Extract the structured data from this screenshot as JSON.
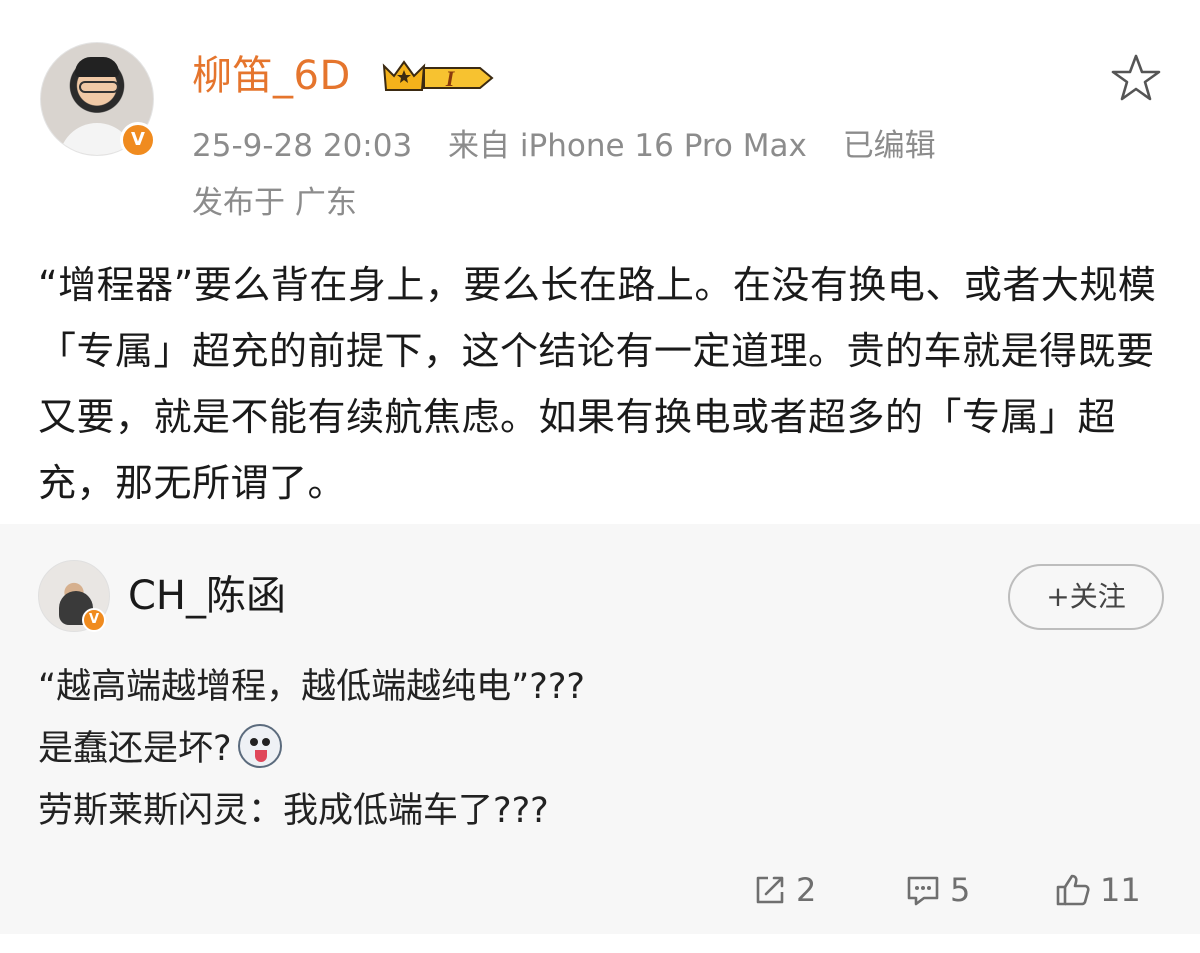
{
  "post": {
    "author": "柳笛_6D",
    "level_badge": "I",
    "timestamp": "25-9-28 20:03",
    "source": "来自 iPhone 16 Pro Max",
    "edited": "已编辑",
    "location": "发布于 广东",
    "text": "“增程器”要么背在身上，要么长在路上。在没有换电、或者大规模「专属」超充的前提下，这个结论有一定道理。贵的车就是得既要又要，就是不能有续航焦虑。如果有换电或者超多的「专属」超充，那无所谓了。",
    "verified_mark": "V"
  },
  "quoted": {
    "author": "CH_陈函",
    "verified_mark": "V",
    "follow_label": "+关注",
    "lines": [
      "“越高端越增程，越低端越纯电”???",
      "是蠢还是坏?",
      "劳斯莱斯闪灵：我成低端车了???"
    ],
    "emoji": "husky-emoji"
  },
  "actions": {
    "share_count": "2",
    "comment_count": "5",
    "like_count": "11"
  },
  "icons": [
    "star-icon",
    "crown-badge-icon",
    "share-icon",
    "comment-icon",
    "like-icon"
  ],
  "colors": {
    "username": "#e5752d",
    "verified": "#f08b1f",
    "meta": "#8c8c8c",
    "quote_bg": "#f7f7f7"
  }
}
